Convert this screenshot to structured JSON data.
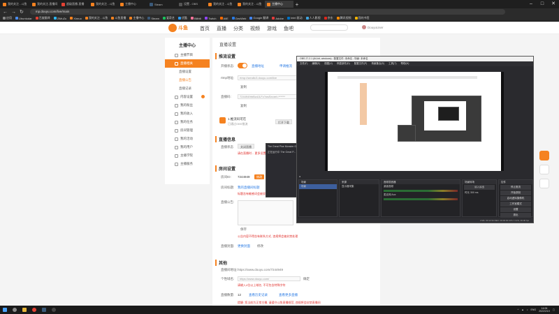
{
  "browser": {
    "tabs": [
      {
        "label": "我的关注 - 斗鱼",
        "active": false
      },
      {
        "label": "我的关注-直播间",
        "active": false
      },
      {
        "label": "超级直播-直播",
        "active": false
      },
      {
        "label": "我的关注 - 斗鱼",
        "active": false
      },
      {
        "label": "主播中心",
        "active": false
      },
      {
        "label": "Steam",
        "active": false
      },
      {
        "label": "设置 - OBS",
        "active": false
      },
      {
        "label": "我的关注 - 斗鱼",
        "active": false
      },
      {
        "label": "我的关注 - 斗鱼",
        "active": false
      },
      {
        "label": "主播中心",
        "active": true
      }
    ],
    "new_tab": "+",
    "url": "mp.douyu.com/live/main",
    "bookmarks": [
      "应用",
      "Ubuntudar",
      "百度翻译",
      "ZiMuZu",
      "Xinruo",
      "我的关注 - 斗鱼",
      "斗鱼直播",
      "主播中心",
      "Steam",
      "爱奇艺",
      "优酷",
      "Bilibili",
      "Twitch",
      "AliE",
      "GeoWeb",
      "Google 翻译",
      "Adobe",
      "Intel 驱动",
      "人人影视",
      "京东",
      "腾讯视频",
      "我的书签"
    ]
  },
  "site": {
    "logo_text": "斗鱼",
    "nav": [
      "首页",
      "直播",
      "分类",
      "视频",
      "游戏",
      "鱼吧"
    ],
    "user_name": "DouyuUser"
  },
  "sidebar": {
    "title": "主播中心",
    "items": [
      {
        "label": "主播节目",
        "type": "item"
      },
      {
        "label": "直播相关",
        "type": "active"
      },
      {
        "label": "直播设置",
        "type": "sub"
      },
      {
        "label": "直播公告",
        "type": "sub-sel"
      },
      {
        "label": "直播记录",
        "type": "sub"
      },
      {
        "label": "内容设置",
        "type": "item"
      },
      {
        "label": "我的粉丝",
        "type": "item"
      },
      {
        "label": "我的收入",
        "type": "item"
      },
      {
        "label": "我的任务",
        "type": "item"
      },
      {
        "label": "房间管理",
        "type": "item"
      },
      {
        "label": "我的活动",
        "type": "item"
      },
      {
        "label": "我的用户",
        "type": "item"
      },
      {
        "label": "主播学院",
        "type": "item"
      },
      {
        "label": "主播服务",
        "type": "item"
      }
    ]
  },
  "main": {
    "crumb": "直播设置",
    "stream_title": "推流设置",
    "stream_switch_label": "开播状态:",
    "stream_link_a": "直播地址",
    "stream_link_b": "申请推流",
    "rtmp_label": "rtmp地址:",
    "rtmp_value": "rtmp://sendtc3.douyu.com/live",
    "copy1": "复制",
    "key_label": "直播码:",
    "key_value": "7244949rbBzdJLFz?wsSecret=******",
    "copy2": "复制",
    "notice_label": "1.推流码可在",
    "notice_sub": "已通过OBS推流",
    "notice_btn": "打开下载",
    "live_section": "直播信息",
    "live_state": "直播状态",
    "live_state_btn": "关闭直播",
    "live_warn": "请在直播时... 更多设置",
    "room_section": "房间设置",
    "room_id_label": "房间ID:",
    "room_id_value": "7244949",
    "room_id_btn": "修改",
    "room_title_label": "房间标题:",
    "room_title_value": "我的直播间标题",
    "room_title_warn": "标题含有敏感词会被驳回",
    "room_notice_label": "直播公告:",
    "save_btn": "保存",
    "notice_warn": "公告内容不得含有联系方式, 违规将会被封禁处理",
    "cover_label": "直播封面:",
    "cover_link": "更换封面",
    "cover_btn": "修改",
    "other_section": "其他",
    "room_url_label": "直播间地址:",
    "room_url_value": "https://www.douyu.com/7244949",
    "short_label": "个性域名:",
    "short_value": "https://www.douyu.com/",
    "short_btn": "确定",
    "short_warn": "请输入4位以上域名, 不可包含特殊字符",
    "count_label": "直播数量:",
    "count_value": "12",
    "count_link1": "查看历史记录",
    "count_link2": "查看更多直播",
    "bottom_warn": "提醒: 您当前为正常主播, 请遵守斗鱼直播规范, 违规将会封禁直播间"
  },
  "obs": {
    "title": "OBS 27.2.1 (64-bit, windows) - 配置文件: 未命名 - 场景: 未命名",
    "menu": [
      "文件(F)",
      "编辑(E)",
      "视图(V)",
      "停靠部件(D)",
      "配置文件(P)",
      "场景集合(S)",
      "工具(T)",
      "帮助(H)"
    ],
    "panels": {
      "scenes": {
        "title": "场景",
        "rows": [
          "场景"
        ]
      },
      "sources": {
        "title": "来源",
        "rows": [
          "显示器采集"
        ]
      },
      "mixer": {
        "title": "音频混音器",
        "rows": [
          "桌面音频",
          "麦克风/Aux"
        ]
      },
      "transitions": {
        "title": "场景转场",
        "rows": [
          "淡入淡出",
          "时长 300 ms"
        ]
      },
      "controls": {
        "title": "控件",
        "buttons": [
          "停止推流",
          "开始录制",
          "启动虚拟摄像机",
          "工作室模式",
          "设置",
          "退出"
        ]
      }
    },
    "status": "LIVE: 00:12:34  REC: 00:00:00  CPU: 3.2%, 30.00 fps"
  },
  "popup": {
    "rows": [
      "The Great Pine Monster Game",
      "正在运行中 The Great P..."
    ]
  },
  "taskbar": {
    "time": "14:06",
    "date": "2022/2/19",
    "lang": "ENG"
  },
  "colors": {
    "accent": "#f58220",
    "link": "#2a7be4",
    "warn": "#e0302c"
  }
}
